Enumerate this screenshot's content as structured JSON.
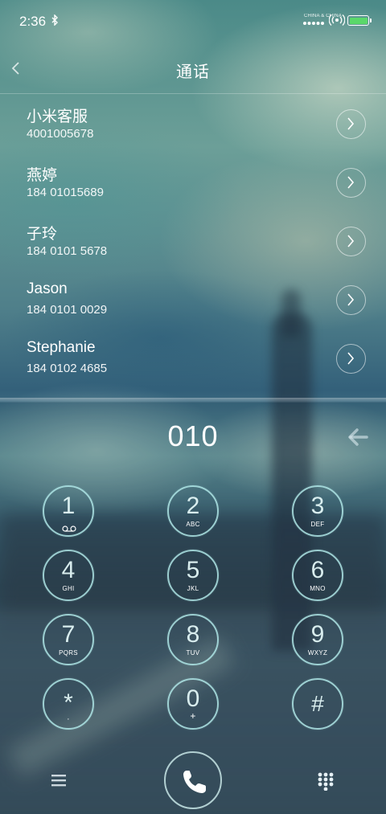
{
  "status_bar": {
    "time": "2:36",
    "carrier": "CHINA & CHINA",
    "battery_color": "#5ad86a",
    "icons": [
      "bluetooth-icon",
      "signal-icon",
      "wifi-icon",
      "battery-icon"
    ]
  },
  "header": {
    "title": "通话",
    "back_icon": "chevron-left-icon"
  },
  "contacts": [
    {
      "name": "小米客服",
      "number": "4001005678"
    },
    {
      "name": "燕婷",
      "number": "184 01015689"
    },
    {
      "name": "子玲",
      "number": "184 0101 5678"
    },
    {
      "name": "Jason",
      "number": "184 0101 0029"
    },
    {
      "name": "Stephanie",
      "number": "184 0102 4685"
    }
  ],
  "dialer": {
    "input": "010",
    "delete_icon": "backspace-arrow-icon"
  },
  "keypad": [
    {
      "digit": "1",
      "letters": ""
    },
    {
      "digit": "2",
      "letters": "ABC"
    },
    {
      "digit": "3",
      "letters": "DEF"
    },
    {
      "digit": "4",
      "letters": "GHI"
    },
    {
      "digit": "5",
      "letters": "JKL"
    },
    {
      "digit": "6",
      "letters": "MNO"
    },
    {
      "digit": "7",
      "letters": "PQRS"
    },
    {
      "digit": "8",
      "letters": "TUV"
    },
    {
      "digit": "9",
      "letters": "WXYZ"
    },
    {
      "digit": "*",
      "letters": ","
    },
    {
      "digit": "0",
      "letters": "+"
    },
    {
      "digit": "#",
      "letters": ""
    }
  ],
  "bottom_bar": {
    "icons": [
      "menu-icon",
      "call-phone-icon",
      "keypad-grid-icon"
    ]
  },
  "colors": {
    "key_ring": "#afe6e6",
    "text": "#ffffff"
  }
}
